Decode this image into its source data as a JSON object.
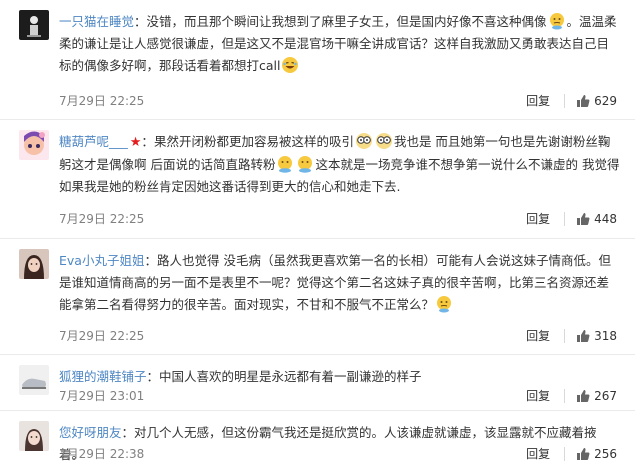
{
  "comments": [
    {
      "user": "一只猫在睡觉",
      "segments": [
        "没错，而且那个瞬间让我想到了麻里子女王，但是国内好像不喜这种偶像",
        "。温温柔柔的谦让是让人感觉很谦虚，但是这又不是混官场干嘛全讲成官话？这样自我激励又勇敢表达自己目标的偶像多好啊，那段话看着都想打call"
      ],
      "time": "7月29日 22:25",
      "reply_label": "回复",
      "likes": "629"
    },
    {
      "user": "糖葫芦呢___",
      "segments": [
        "果然开闭粉都更加容易被这样的吸引",
        "我也是 而且她第一句也是先谢谢粉丝鞠躬这才是偶像啊 后面说的话简直路转粉",
        "这本就是一场竞争谁不想争第一说什么不谦虚的 我觉得如果我是她的粉丝肯定因她这番话得到更大的信心和她走下去."
      ],
      "time": "7月29日 22:25",
      "reply_label": "回复",
      "likes": "448"
    },
    {
      "user": "Eva小丸子姐姐",
      "segments": [
        "路人也觉得 没毛病（虽然我更喜欢第一名的长相）可能有人会说这妹子情商低。但是谁知道情商高的另一面不是表里不一呢？觉得这个第二名这妹子真的很辛苦啊，比第三名资源还差能拿第二名看得努力的很辛苦。面对现实，不甘和不服气不正常么？"
      ],
      "time": "7月29日 22:25",
      "reply_label": "回复",
      "likes": "318"
    },
    {
      "user": "狐狸的潮鞋铺子",
      "segments": [
        "中国人喜欢的明星是永远都有着一副谦逊的样子"
      ],
      "time": "7月29日 23:01",
      "reply_label": "回复",
      "likes": "267"
    },
    {
      "user": "您好呀朋友",
      "segments": [
        "对几个人无感，但这份霸气我还是挺欣赏的。人该谦虚就谦虚，该显露就不应藏着掖着。"
      ],
      "time": "7月29日 22:38",
      "reply_label": "回复",
      "likes": "256"
    }
  ],
  "colors": {
    "username": "#4e87c4",
    "text": "#333333",
    "meta": "#808080",
    "divider": "#ebebeb"
  },
  "icons": {
    "like": "thumbs-up-icon",
    "emoji_thinking": "thinking-face-emoji",
    "emoji_laugh": "laughing-face-emoji",
    "emoji_glasses": "glasses-emoji",
    "emoji_doge": "doge-emoji",
    "vip": "red-star-icon"
  }
}
